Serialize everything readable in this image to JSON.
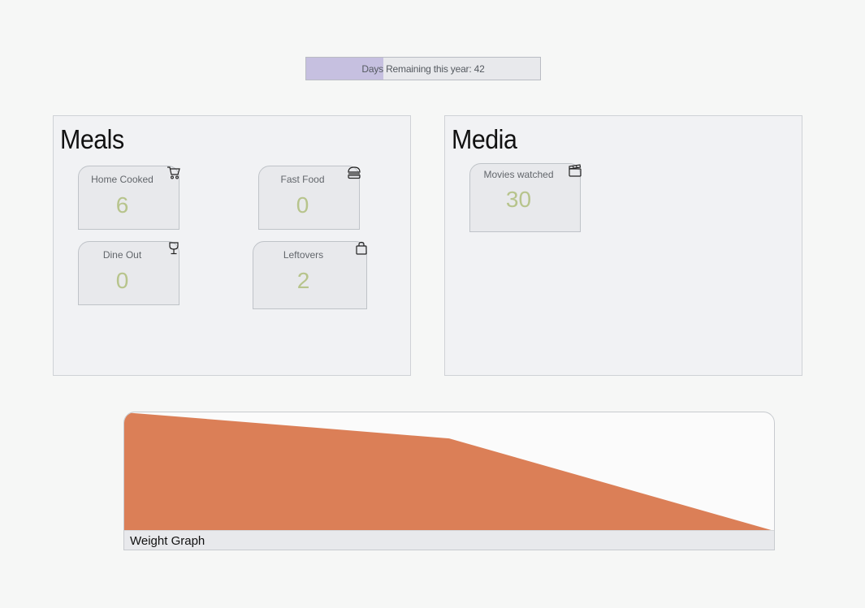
{
  "progress": {
    "label": "Days Remaining this year: 42",
    "fill_fraction": 0.33,
    "fill_color": "#c6c0e0"
  },
  "meals": {
    "title": "Meals",
    "cards": [
      {
        "label": "Home Cooked",
        "value": "6",
        "icon": "shopping-cart-icon"
      },
      {
        "label": "Fast Food",
        "value": "0",
        "icon": "burger-icon"
      },
      {
        "label": "Dine Out",
        "value": "0",
        "icon": "wine-glass-icon"
      },
      {
        "label": "Leftovers",
        "value": "2",
        "icon": "shopping-bag-icon"
      }
    ]
  },
  "media": {
    "title": "Media",
    "cards": [
      {
        "label": "Movies watched",
        "value": "30",
        "icon": "clapperboard-icon"
      }
    ]
  },
  "weight_graph": {
    "label": "Weight Graph",
    "fill_color": "#db7f57"
  },
  "chart_data": {
    "type": "area",
    "x": [
      0,
      1,
      2
    ],
    "values": [
      1.0,
      0.78,
      0.0
    ],
    "ylim": [
      0,
      1
    ],
    "grid": false
  }
}
